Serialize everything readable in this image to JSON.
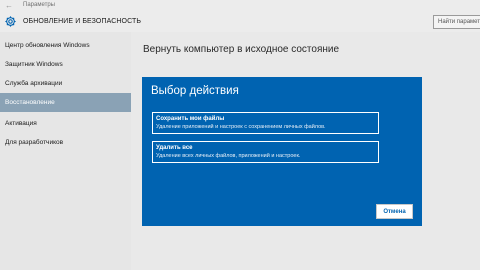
{
  "window": {
    "title": "Параметры",
    "back_icon": "arrow-left-icon"
  },
  "header": {
    "icon": "gear-icon",
    "section_title": "ОБНОВЛЕНИЕ И БЕЗОПАСНОСТЬ",
    "search_placeholder": "Найти параметр"
  },
  "sidebar": {
    "items": [
      {
        "label": "Центр обновления Windows",
        "active": false
      },
      {
        "label": "Защитник Windows",
        "active": false
      },
      {
        "label": "Служба архивации",
        "active": false
      },
      {
        "label": "Восстановление",
        "active": true
      },
      {
        "label": "Активация",
        "active": false
      },
      {
        "label": "Для разработчиков",
        "active": false
      }
    ]
  },
  "main": {
    "title": "Вернуть компьютер в исходное состояние"
  },
  "dialog": {
    "title": "Выбор действия",
    "options": [
      {
        "label": "Сохранить мои файлы",
        "description": "Удаление приложений и настроек с сохранением личных файлов."
      },
      {
        "label": "Удалить все",
        "description": "Удаление всех личных файлов, приложений и настроек."
      }
    ],
    "cancel_label": "Отмена"
  },
  "colors": {
    "accent": "#0063b1",
    "sidebar_active": "#8aa2b5",
    "background": "#e6e6e6"
  }
}
